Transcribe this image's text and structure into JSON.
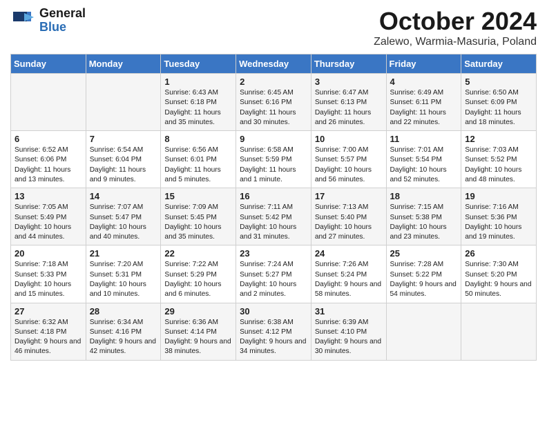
{
  "header": {
    "logo_general": "General",
    "logo_blue": "Blue",
    "month": "October 2024",
    "location": "Zalewo, Warmia-Masuria, Poland"
  },
  "days_of_week": [
    "Sunday",
    "Monday",
    "Tuesday",
    "Wednesday",
    "Thursday",
    "Friday",
    "Saturday"
  ],
  "weeks": [
    [
      {
        "day": "",
        "sunrise": "",
        "sunset": "",
        "daylight": ""
      },
      {
        "day": "",
        "sunrise": "",
        "sunset": "",
        "daylight": ""
      },
      {
        "day": "1",
        "sunrise": "Sunrise: 6:43 AM",
        "sunset": "Sunset: 6:18 PM",
        "daylight": "Daylight: 11 hours and 35 minutes."
      },
      {
        "day": "2",
        "sunrise": "Sunrise: 6:45 AM",
        "sunset": "Sunset: 6:16 PM",
        "daylight": "Daylight: 11 hours and 30 minutes."
      },
      {
        "day": "3",
        "sunrise": "Sunrise: 6:47 AM",
        "sunset": "Sunset: 6:13 PM",
        "daylight": "Daylight: 11 hours and 26 minutes."
      },
      {
        "day": "4",
        "sunrise": "Sunrise: 6:49 AM",
        "sunset": "Sunset: 6:11 PM",
        "daylight": "Daylight: 11 hours and 22 minutes."
      },
      {
        "day": "5",
        "sunrise": "Sunrise: 6:50 AM",
        "sunset": "Sunset: 6:09 PM",
        "daylight": "Daylight: 11 hours and 18 minutes."
      }
    ],
    [
      {
        "day": "6",
        "sunrise": "Sunrise: 6:52 AM",
        "sunset": "Sunset: 6:06 PM",
        "daylight": "Daylight: 11 hours and 13 minutes."
      },
      {
        "day": "7",
        "sunrise": "Sunrise: 6:54 AM",
        "sunset": "Sunset: 6:04 PM",
        "daylight": "Daylight: 11 hours and 9 minutes."
      },
      {
        "day": "8",
        "sunrise": "Sunrise: 6:56 AM",
        "sunset": "Sunset: 6:01 PM",
        "daylight": "Daylight: 11 hours and 5 minutes."
      },
      {
        "day": "9",
        "sunrise": "Sunrise: 6:58 AM",
        "sunset": "Sunset: 5:59 PM",
        "daylight": "Daylight: 11 hours and 1 minute."
      },
      {
        "day": "10",
        "sunrise": "Sunrise: 7:00 AM",
        "sunset": "Sunset: 5:57 PM",
        "daylight": "Daylight: 10 hours and 56 minutes."
      },
      {
        "day": "11",
        "sunrise": "Sunrise: 7:01 AM",
        "sunset": "Sunset: 5:54 PM",
        "daylight": "Daylight: 10 hours and 52 minutes."
      },
      {
        "day": "12",
        "sunrise": "Sunrise: 7:03 AM",
        "sunset": "Sunset: 5:52 PM",
        "daylight": "Daylight: 10 hours and 48 minutes."
      }
    ],
    [
      {
        "day": "13",
        "sunrise": "Sunrise: 7:05 AM",
        "sunset": "Sunset: 5:49 PM",
        "daylight": "Daylight: 10 hours and 44 minutes."
      },
      {
        "day": "14",
        "sunrise": "Sunrise: 7:07 AM",
        "sunset": "Sunset: 5:47 PM",
        "daylight": "Daylight: 10 hours and 40 minutes."
      },
      {
        "day": "15",
        "sunrise": "Sunrise: 7:09 AM",
        "sunset": "Sunset: 5:45 PM",
        "daylight": "Daylight: 10 hours and 35 minutes."
      },
      {
        "day": "16",
        "sunrise": "Sunrise: 7:11 AM",
        "sunset": "Sunset: 5:42 PM",
        "daylight": "Daylight: 10 hours and 31 minutes."
      },
      {
        "day": "17",
        "sunrise": "Sunrise: 7:13 AM",
        "sunset": "Sunset: 5:40 PM",
        "daylight": "Daylight: 10 hours and 27 minutes."
      },
      {
        "day": "18",
        "sunrise": "Sunrise: 7:15 AM",
        "sunset": "Sunset: 5:38 PM",
        "daylight": "Daylight: 10 hours and 23 minutes."
      },
      {
        "day": "19",
        "sunrise": "Sunrise: 7:16 AM",
        "sunset": "Sunset: 5:36 PM",
        "daylight": "Daylight: 10 hours and 19 minutes."
      }
    ],
    [
      {
        "day": "20",
        "sunrise": "Sunrise: 7:18 AM",
        "sunset": "Sunset: 5:33 PM",
        "daylight": "Daylight: 10 hours and 15 minutes."
      },
      {
        "day": "21",
        "sunrise": "Sunrise: 7:20 AM",
        "sunset": "Sunset: 5:31 PM",
        "daylight": "Daylight: 10 hours and 10 minutes."
      },
      {
        "day": "22",
        "sunrise": "Sunrise: 7:22 AM",
        "sunset": "Sunset: 5:29 PM",
        "daylight": "Daylight: 10 hours and 6 minutes."
      },
      {
        "day": "23",
        "sunrise": "Sunrise: 7:24 AM",
        "sunset": "Sunset: 5:27 PM",
        "daylight": "Daylight: 10 hours and 2 minutes."
      },
      {
        "day": "24",
        "sunrise": "Sunrise: 7:26 AM",
        "sunset": "Sunset: 5:24 PM",
        "daylight": "Daylight: 9 hours and 58 minutes."
      },
      {
        "day": "25",
        "sunrise": "Sunrise: 7:28 AM",
        "sunset": "Sunset: 5:22 PM",
        "daylight": "Daylight: 9 hours and 54 minutes."
      },
      {
        "day": "26",
        "sunrise": "Sunrise: 7:30 AM",
        "sunset": "Sunset: 5:20 PM",
        "daylight": "Daylight: 9 hours and 50 minutes."
      }
    ],
    [
      {
        "day": "27",
        "sunrise": "Sunrise: 6:32 AM",
        "sunset": "Sunset: 4:18 PM",
        "daylight": "Daylight: 9 hours and 46 minutes."
      },
      {
        "day": "28",
        "sunrise": "Sunrise: 6:34 AM",
        "sunset": "Sunset: 4:16 PM",
        "daylight": "Daylight: 9 hours and 42 minutes."
      },
      {
        "day": "29",
        "sunrise": "Sunrise: 6:36 AM",
        "sunset": "Sunset: 4:14 PM",
        "daylight": "Daylight: 9 hours and 38 minutes."
      },
      {
        "day": "30",
        "sunrise": "Sunrise: 6:38 AM",
        "sunset": "Sunset: 4:12 PM",
        "daylight": "Daylight: 9 hours and 34 minutes."
      },
      {
        "day": "31",
        "sunrise": "Sunrise: 6:39 AM",
        "sunset": "Sunset: 4:10 PM",
        "daylight": "Daylight: 9 hours and 30 minutes."
      },
      {
        "day": "",
        "sunrise": "",
        "sunset": "",
        "daylight": ""
      },
      {
        "day": "",
        "sunrise": "",
        "sunset": "",
        "daylight": ""
      }
    ]
  ]
}
